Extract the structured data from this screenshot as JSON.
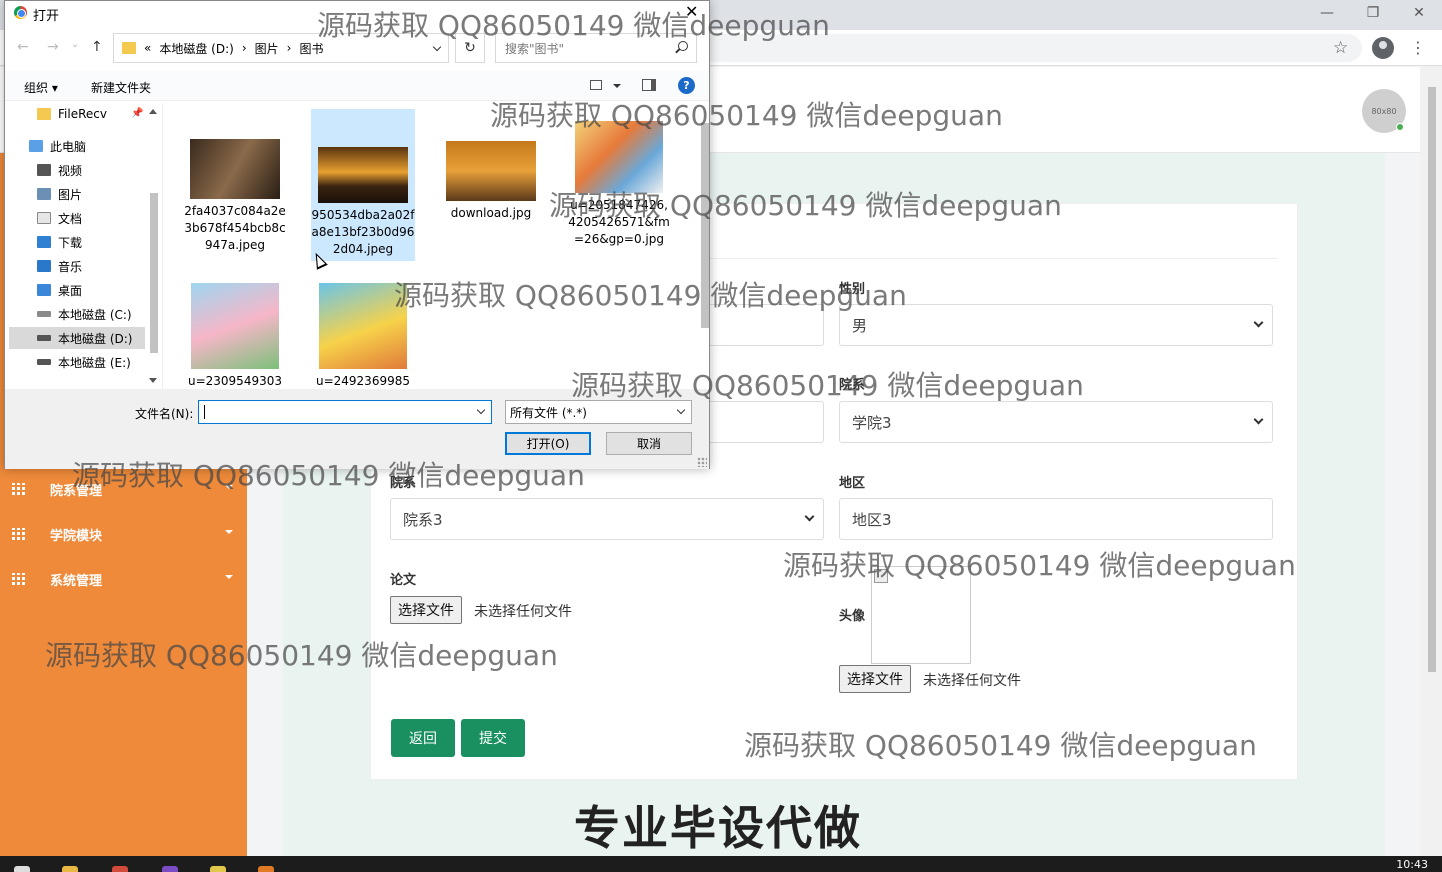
{
  "browser": {
    "window_controls": [
      "—",
      "❐",
      "✕"
    ],
    "star_icon": "☆",
    "menu_icon": "⋮"
  },
  "header": {
    "avatar_text": "80x80"
  },
  "sidebar": {
    "items": [
      {
        "label": "院系管理"
      },
      {
        "label": "学院模块"
      },
      {
        "label": "系统管理"
      }
    ]
  },
  "form": {
    "gender_label": "性别",
    "gender_value": "男",
    "college_label": "院系",
    "college_value": "学院3",
    "dept_label": "院系",
    "dept_value": "院系3",
    "region_label": "地区",
    "region_value": "地区3",
    "paper_label": "论文",
    "choose_file": "选择文件",
    "no_file": "未选择任何文件",
    "avatar_label": "头像",
    "back_button": "返回",
    "submit_button": "提交"
  },
  "taskbar": {
    "clock": "10:43"
  },
  "dialog": {
    "title": "打开",
    "close": "✕",
    "nav": {
      "back": "←",
      "forward": "→",
      "recent": "⌄",
      "up": "↑"
    },
    "address": {
      "prefix": "«",
      "drive": "本地磁盘 (D:)",
      "sep1": "›",
      "folder1": "图片",
      "sep2": "›",
      "folder2": "图书"
    },
    "refresh": "↻",
    "search_placeholder": "搜索\"图书\"",
    "toolbar": {
      "organize": "组织 ▾",
      "new_folder": "新建文件夹",
      "help": "?"
    },
    "tree": [
      {
        "label": "FileRecv"
      },
      {
        "label": "此电脑"
      },
      {
        "label": "视频"
      },
      {
        "label": "图片"
      },
      {
        "label": "文档"
      },
      {
        "label": "下载"
      },
      {
        "label": "音乐"
      },
      {
        "label": "桌面"
      },
      {
        "label": "本地磁盘 (C:)"
      },
      {
        "label": "本地磁盘 (D:)"
      },
      {
        "label": "本地磁盘 (E:)"
      }
    ],
    "files": [
      {
        "name": "2fa4037c084a2e3b678f454bcb8c947a.jpeg"
      },
      {
        "name": "950534dba2a02fa8e13bf23b0d962d04.jpeg"
      },
      {
        "name": "download.jpg"
      },
      {
        "name": "u=2051847426,4205426571&fm=26&gp=0.jpg"
      },
      {
        "name": "u=2309549303"
      },
      {
        "name": "u=2492369985"
      }
    ],
    "filename_label": "文件名(N):",
    "filetype_value": "所有文件 (*.*)",
    "open_button": "打开(O)",
    "cancel_button": "取消"
  },
  "watermark": {
    "text": "源码获取 QQ86050149 微信deepguan"
  },
  "banner": {
    "text": "专业毕设代做"
  },
  "colors": {
    "sidebar": "#ee8a3a",
    "primary_button": "#1a9060",
    "dialog_accent": "#0078d7"
  }
}
